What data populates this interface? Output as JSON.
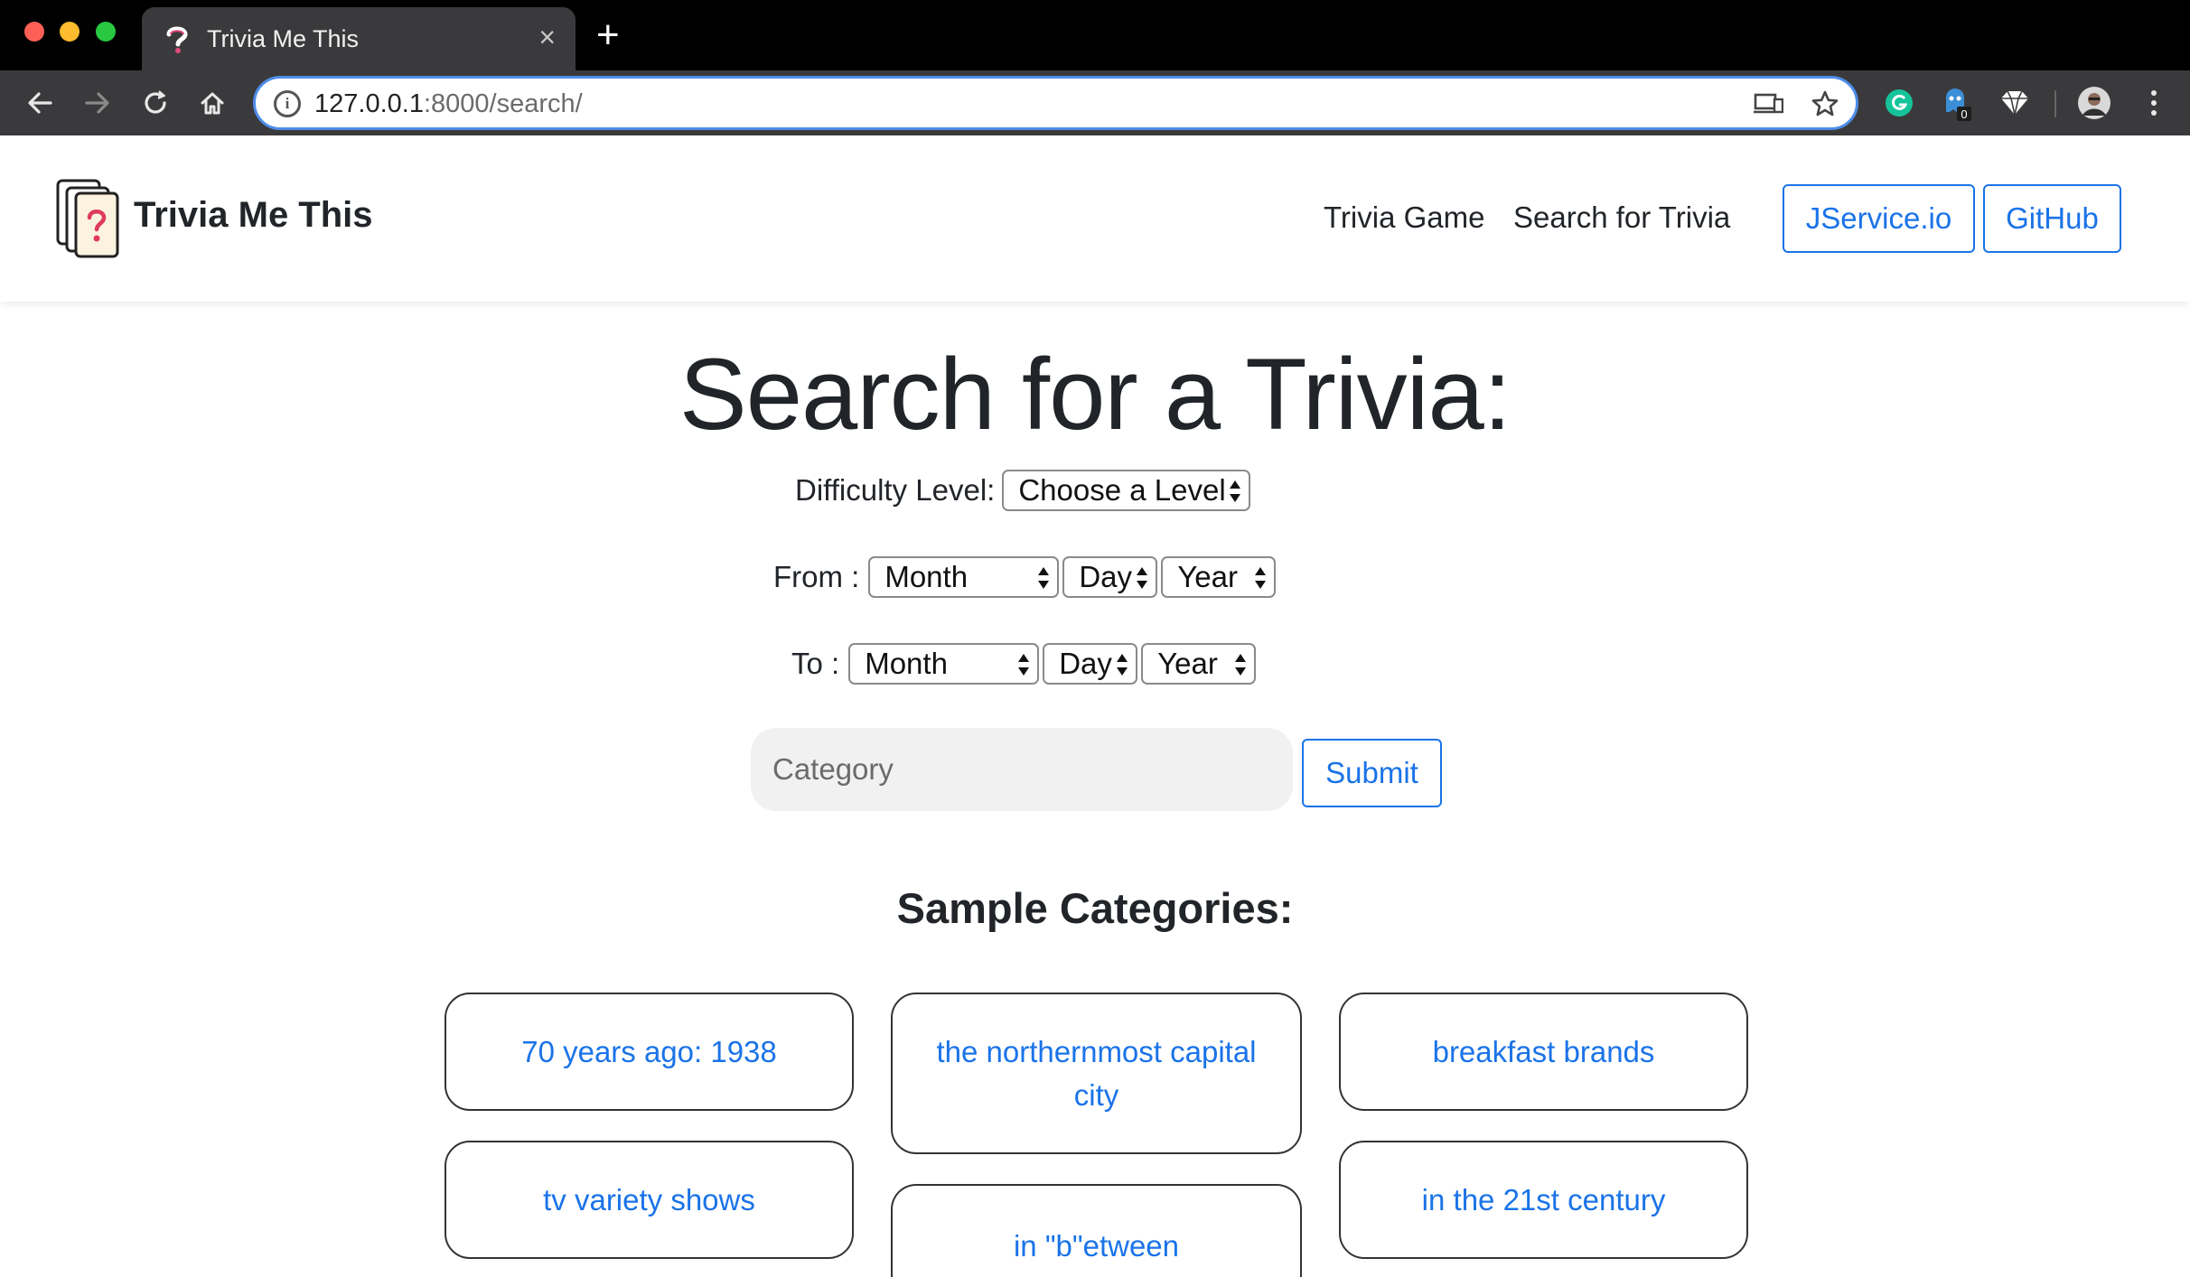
{
  "browser": {
    "tab_title": "Trivia Me This",
    "close_glyph": "×",
    "new_tab_glyph": "+",
    "url_host": "127.0.0.1",
    "url_path": ":8000/search/"
  },
  "extensions": {
    "badge_count": "0"
  },
  "navbar": {
    "brand": "Trivia Me This",
    "links": [
      "Trivia Game",
      "Search for Trivia"
    ],
    "buttons": [
      "JService.io",
      "GitHub"
    ]
  },
  "search": {
    "title": "Search for a Trivia:",
    "difficulty_label": "Difficulty Level:",
    "difficulty_value": "Choose a Level",
    "from_label": "From :",
    "to_label": "To :",
    "month": "Month",
    "day": "Day",
    "year": "Year",
    "category_placeholder": "Category",
    "submit_label": "Submit"
  },
  "samples": {
    "title": "Sample Categories:",
    "categories": [
      "70 years ago: 1938",
      "the northernmost capital city",
      "breakfast brands",
      "tv variety shows",
      "in \"b\"etween",
      "in the 21st century"
    ]
  },
  "colors": {
    "accent": "#1a73e8",
    "omnibox_border": "#4d8de8"
  }
}
